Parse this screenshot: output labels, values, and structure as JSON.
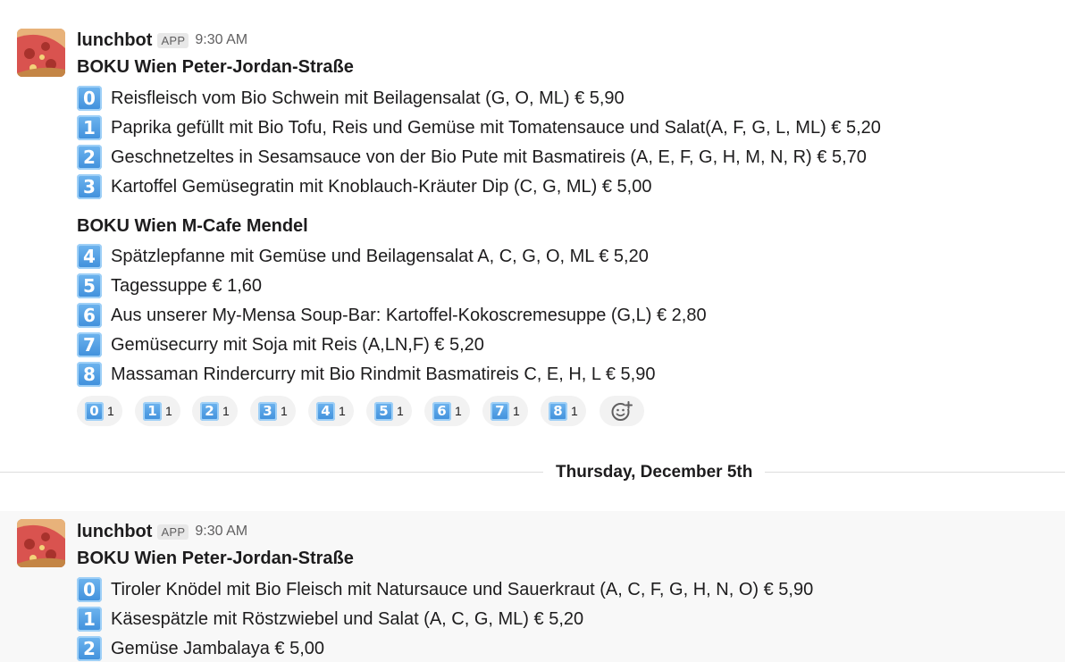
{
  "messages": [
    {
      "username": "lunchbot",
      "app_badge": "APP",
      "time": "9:30 AM",
      "sections": [
        {
          "title": "BOKU Wien Peter-Jordan-Straße",
          "items": [
            {
              "key": "0",
              "text": "Reisfleisch vom Bio Schwein mit Beilagensalat (G, O, ML) € 5,90"
            },
            {
              "key": "1",
              "text": "Paprika gefüllt mit Bio Tofu, Reis und Gemüse mit Tomatensauce und Salat(A, F, G, L, ML) € 5,20"
            },
            {
              "key": "2",
              "text": "Geschnetzeltes in Sesamsauce von der Bio Pute mit Basmatireis (A, E, F, G, H, M, N, R) € 5,70"
            },
            {
              "key": "3",
              "text": "Kartoffel Gemüsegratin mit Knoblauch-Kräuter Dip (C, G, ML) € 5,00"
            }
          ]
        },
        {
          "title": "BOKU Wien M-Cafe Mendel",
          "items": [
            {
              "key": "4",
              "text": "Spätzlepfanne mit Gemüse und Beilagensalat A, C, G, O, ML € 5,20"
            },
            {
              "key": "5",
              "text": "Tagessuppe € 1,60"
            },
            {
              "key": "6",
              "text": "Aus unserer My-Mensa Soup-Bar: Kartoffel-Kokoscremesuppe (G,L) € 2,80"
            },
            {
              "key": "7",
              "text": "Gemüsecurry mit Soja mit Reis (A,LN,F) € 5,20"
            },
            {
              "key": "8",
              "text": "Massaman Rindercurry mit Bio Rindmit Basmatireis C, E, H, L € 5,90"
            }
          ]
        }
      ],
      "reactions": [
        {
          "key": "0",
          "count": "1"
        },
        {
          "key": "1",
          "count": "1"
        },
        {
          "key": "2",
          "count": "1"
        },
        {
          "key": "3",
          "count": "1"
        },
        {
          "key": "4",
          "count": "1"
        },
        {
          "key": "5",
          "count": "1"
        },
        {
          "key": "6",
          "count": "1"
        },
        {
          "key": "7",
          "count": "1"
        },
        {
          "key": "8",
          "count": "1"
        }
      ],
      "add_reaction_icon": "add-emoji-icon"
    },
    {
      "username": "lunchbot",
      "app_badge": "APP",
      "time": "9:30 AM",
      "sections": [
        {
          "title": "BOKU Wien Peter-Jordan-Straße",
          "items": [
            {
              "key": "0",
              "text": "Tiroler Knödel mit Bio Fleisch mit Natursauce und Sauerkraut (A, C, F, G, H, N, O) € 5,90"
            },
            {
              "key": "1",
              "text": "Käsespätzle mit Röstzwiebel und Salat (A, C, G, ML) € 5,20"
            },
            {
              "key": "2",
              "text": "Gemüse Jambalaya € 5,00"
            }
          ]
        }
      ]
    }
  ],
  "date_divider": "Thursday, December 5th",
  "colors": {
    "keycap": "#3f8fdb",
    "highlight_bg": "#f8f8f8",
    "divider": "#dddddd"
  }
}
